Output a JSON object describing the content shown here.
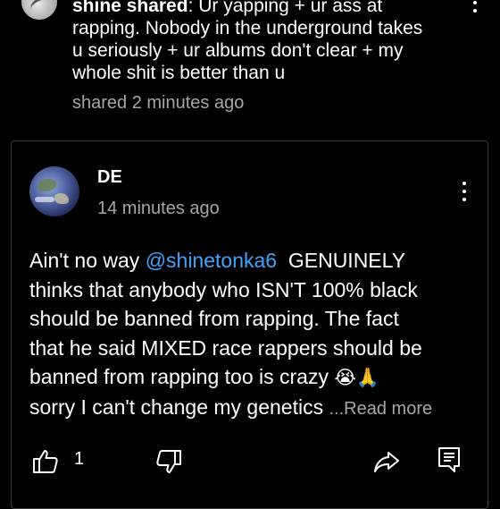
{
  "top_post": {
    "author": "shine shared",
    "text_lines": [
      ": Ur yapping + ur ass at",
      "rapping. Nobody in the underground takes",
      "u seriously + ur albums don't clear + my",
      "whole shit is better than u"
    ],
    "meta": "shared 2 minutes ago"
  },
  "comment": {
    "author": "DE",
    "time": "14 minutes ago",
    "body_prefix": "Ain't no way ",
    "mention": "@shinetonka6",
    "body_line1_rest": "  GENUINELY",
    "body_line2": "thinks that anybody who ISN'T 100% black",
    "body_line3": "should be banned from rapping. The fact",
    "body_line4": "that he said MIXED race rappers should be",
    "body_line5": "banned from rapping too is crazy ",
    "body_emoji": "😭🙏",
    "body_line6": "sorry I can't change my genetics ",
    "read_more": "...Read more",
    "like_count": "1"
  },
  "icons": {
    "top_more": "more-vert-icon",
    "card_more": "more-vert-icon",
    "like": "thumbs-up-icon",
    "dislike": "thumbs-down-icon",
    "share": "share-icon",
    "reply": "comment-icon"
  },
  "colors": {
    "background": "#000000",
    "text": "#ffffff",
    "secondary_text": "#a6a6a6",
    "mention": "#3ea6ff",
    "card_border": "#3a3a3a"
  }
}
